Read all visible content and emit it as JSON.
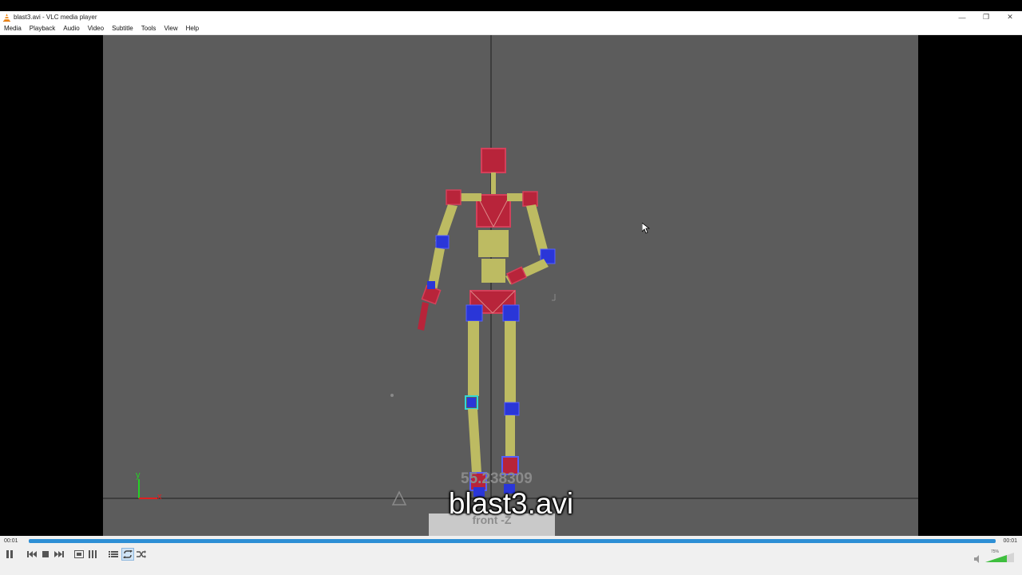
{
  "window": {
    "title": "blast3.avi - VLC media player",
    "minimize_glyph": "—",
    "restore_glyph": "❐",
    "close_glyph": "✕"
  },
  "menu": {
    "items": [
      "Media",
      "Playback",
      "Audio",
      "Video",
      "Subtitle",
      "Tools",
      "View",
      "Help"
    ]
  },
  "video": {
    "subtitle": "blast3.avi",
    "frame_number": "55.238309",
    "view_label": "front -Z",
    "axis_y": "y",
    "axis_x": "x"
  },
  "player": {
    "time_elapsed": "00:01",
    "time_total": "00:01",
    "progress": 1.0,
    "volume_label": "75%",
    "volume": 0.75
  },
  "colors": {
    "accent": "#2d8fd5",
    "video_bg": "#5c5c5c"
  }
}
